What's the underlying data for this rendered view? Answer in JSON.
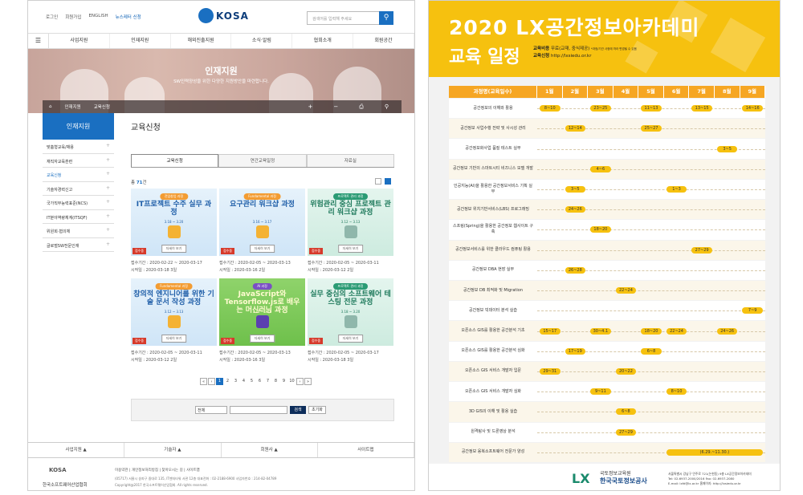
{
  "left": {
    "toplinks": [
      "로그인",
      "회원가입",
      "ENGLISH",
      "뉴스레터 신청"
    ],
    "logo_text": "KOSA",
    "search_placeholder": "검색어를 입력해 주세요",
    "gnb": [
      "사업지원",
      "인재지원",
      "해외진출지원",
      "소식·알림",
      "협회소개",
      "회원공간"
    ],
    "hero_title": "인재지원",
    "hero_sub": "SW인력양성을 위한 다양한 지원방안을 마련합니다.",
    "breadcrumb": [
      "인재지원",
      "교육신청"
    ],
    "side_head": "인재지원",
    "side_items": [
      "맞춤형교육/채용",
      "재직자교육훈련",
      "교육신청",
      "기술자경력신고",
      "국가직무능력표준(NCS)",
      "IT분야역량체계(ITSQF)",
      "위원회·협의체",
      "글로벌SW전문인재"
    ],
    "active_side": 2,
    "page_title": "교육신청",
    "tabs": [
      "교육신청",
      "연간교육일정",
      "자료실"
    ],
    "count_label": "총",
    "count": "71",
    "count_unit": "건",
    "cards": [
      {
        "tag": "전임창업 과정",
        "title": "IT프로젝트 수주 실무 과정",
        "date": "3.18 ~ 3.20",
        "status": "접수중",
        "more": "자세히 보기",
        "period": "접수기간 : 2020-02-22 ~ 2020-03-17",
        "ann": "시작일 : 2020-03-18 3일",
        "theme": "blue"
      },
      {
        "tag": "Fundamental 과정",
        "title": "요구관리 워크샵 과정",
        "date": "3.16 ~ 3.17",
        "status": "접수중",
        "more": "자세히 보기",
        "period": "접수기간 : 2020-02-05 ~ 2020-03-13",
        "ann": "시작일 : 2020-03-16 2일",
        "theme": "blue"
      },
      {
        "tag": "프로젝트 관리 과정",
        "title": "위험관리 중심 프로젝트 관리 워크샵 과정",
        "date": "3.12 ~ 3.13",
        "status": "접수중",
        "more": "자세히 보기",
        "period": "접수기간 : 2020-02-05 ~ 2020-03-11",
        "ann": "시작일 : 2020-03-12 2일",
        "theme": "teal"
      },
      {
        "tag": "Fundamental 과정",
        "title": "창의적 엔지니어를 위한 기술 문서 작성 과정",
        "date": "3.12 ~ 3.13",
        "status": "접수중",
        "more": "자세히 보기",
        "period": "접수기간 : 2020-02-05 ~ 2020-03-11",
        "ann": "시작일 : 2020-03-12 2일",
        "theme": "blue"
      },
      {
        "tag": "AI 과정",
        "title": "JavaScript와 Tensorflow.js로 배우는 머신러닝 과정",
        "date": "3.16 ~ 3.18",
        "status": "접수중",
        "more": "자세히 보기",
        "period": "접수기간 : 2020-02-05 ~ 2020-03-13",
        "ann": "시작일 : 2020-03-16 3일",
        "theme": "green"
      },
      {
        "tag": "프로젝트 관리 과정",
        "title": "실무 중심의 소프트웨어 테스팅 전문 과정",
        "date": "3.18 ~ 3.20",
        "status": "접수중",
        "more": "자세히 보기",
        "period": "접수기간 : 2020-02-05 ~ 2020-03-17",
        "ann": "시작일 : 2020-03-18 3일",
        "theme": "teal"
      }
    ],
    "pager": [
      "«",
      "‹",
      "1",
      "2",
      "3",
      "4",
      "5",
      "6",
      "7",
      "8",
      "9",
      "10",
      "›",
      "»"
    ],
    "select_value": "전체",
    "search_btn": "검색",
    "reset_btn": "초기화",
    "footer_nav": [
      "사업지원 ▲",
      "기술자 ▲",
      "회원사 ▲",
      "사이트맵"
    ],
    "footer_logo": "KOSA",
    "footer_org": "한국소프트웨어산업협회",
    "footer_links": "이용약관 | 개인정보처리방침 | 찾아오시는 길 | 사이트맵",
    "footer_addr": "(05717) 서울시 송파구 중대로 135, IT벤처타워 서관 12층 대표전화 : 02-2188-6900 사업자번호 : 214-82-04789",
    "footer_copy": "Copyright@2017 한국소프트웨어산업협회. All rights reserved."
  },
  "right": {
    "title": "2020 LX공간정보아카데미",
    "subtitle": "교육 일정",
    "fee_label": "교육비용",
    "fee": "무료(교재, 중식제공)",
    "fee_note": "*과정/기관 사정에 따라 변경될 수 있음",
    "apply_label": "교육신청",
    "apply": "http://lxsiedu.or.kr",
    "header_first": "과정명(교육일수)",
    "months": [
      "1월",
      "2월",
      "3월",
      "4월",
      "5월",
      "6월",
      "7월",
      "8월",
      "9월"
    ],
    "rows": [
      {
        "name": "공간정보의 이해와 활용",
        "pills": [
          {
            "m": 1,
            "t": "8~10"
          },
          {
            "m": 3,
            "t": "23~25"
          },
          {
            "m": 5,
            "t": "11~13"
          },
          {
            "m": 7,
            "t": "13~15"
          },
          {
            "m": 9,
            "t": "14~16"
          }
        ]
      },
      {
        "name": "공간정보 사업수행 전략 및 사시성 관리",
        "pills": [
          {
            "m": 2,
            "t": "12~14"
          },
          {
            "m": 5,
            "t": "25~27"
          }
        ]
      },
      {
        "name": "공간정보화사업 품질 테스트 실무",
        "pills": [
          {
            "m": 8,
            "t": "3~5"
          }
        ]
      },
      {
        "name": "공간정보 기반의 스마트시티 비즈니스 모델 개발",
        "pills": [
          {
            "m": 3,
            "t": "4~6"
          }
        ]
      },
      {
        "name": "인공지능(AI)을 활용한 공간정보서비스 기획 실무",
        "pills": [
          {
            "m": 2,
            "t": "3~5"
          },
          {
            "m": 6,
            "t": "1~3"
          }
        ]
      },
      {
        "name": "공간정보 위치기반서비스(LBS) 프로그래밍",
        "pills": [
          {
            "m": 2,
            "t": "24~26"
          }
        ]
      },
      {
        "name": "스프링(Spring)을 활용한 공간정보 웹사이트 구축",
        "pills": [
          {
            "m": 3,
            "t": "18~20"
          }
        ]
      },
      {
        "name": "공간정보서비스를 위한 클라우드 컴퓨팅 활용",
        "pills": [
          {
            "m": 7,
            "t": "27~29"
          }
        ]
      },
      {
        "name": "공간정보 DBA 현장 실무",
        "pills": [
          {
            "m": 2,
            "t": "26~28"
          }
        ]
      },
      {
        "name": "공간정보 DB 최적화 및 Migration",
        "pills": [
          {
            "m": 4,
            "t": "22~24"
          }
        ]
      },
      {
        "name": "공간정보 빅데이터 분석 실습",
        "pills": [
          {
            "m": 9,
            "t": "7~9"
          }
        ]
      },
      {
        "name": "오픈소스 GIS를 활용한 공간분석 기초",
        "pills": [
          {
            "m": 1,
            "t": "15~17"
          },
          {
            "m": 3,
            "t": "30~4.1"
          },
          {
            "m": 5,
            "t": "18~20"
          },
          {
            "m": 6,
            "t": "22~24"
          },
          {
            "m": 8,
            "t": "24~26"
          }
        ]
      },
      {
        "name": "오픈소스 GIS를 활용한 공간분석 심화",
        "pills": [
          {
            "m": 2,
            "t": "17~19"
          },
          {
            "m": 5,
            "t": "6~8"
          }
        ]
      },
      {
        "name": "오픈소스 GIS 서비스 개발자 입문",
        "pills": [
          {
            "m": 1,
            "t": "29~31"
          },
          {
            "m": 4,
            "t": "20~22"
          }
        ]
      },
      {
        "name": "오픈소스 GIS 서비스 개발자 심화",
        "pills": [
          {
            "m": 3,
            "t": "9~11"
          },
          {
            "m": 6,
            "t": "8~10"
          }
        ]
      },
      {
        "name": "3D GIS의 이해 및 활용 실습",
        "pills": [
          {
            "m": 4,
            "t": "6~8"
          }
        ]
      },
      {
        "name": "원격탐사 및 드론영상 분석",
        "pills": [
          {
            "m": 4,
            "t": "27~29"
          }
        ]
      },
      {
        "name": "공간정보 융복소프트웨어 전문가 양성",
        "pills": [
          {
            "m": 6,
            "t": "(6.29.~11.30.)",
            "span": 4
          }
        ]
      }
    ],
    "lx_logo": "LX",
    "org1": "국토정보교육원",
    "org2": "한국국토정보공사",
    "addr1": "서울특별시 강남구 언주로 721(논현동) 9층 LX공간정보아카데미",
    "addr2": "Tel: 02-6937-2000/2016  Fax: 02-6937-2080",
    "addr3": "E-mail: lxfd@lx.or.kr   홈페이지: http://lxsiedu.or.kr"
  }
}
